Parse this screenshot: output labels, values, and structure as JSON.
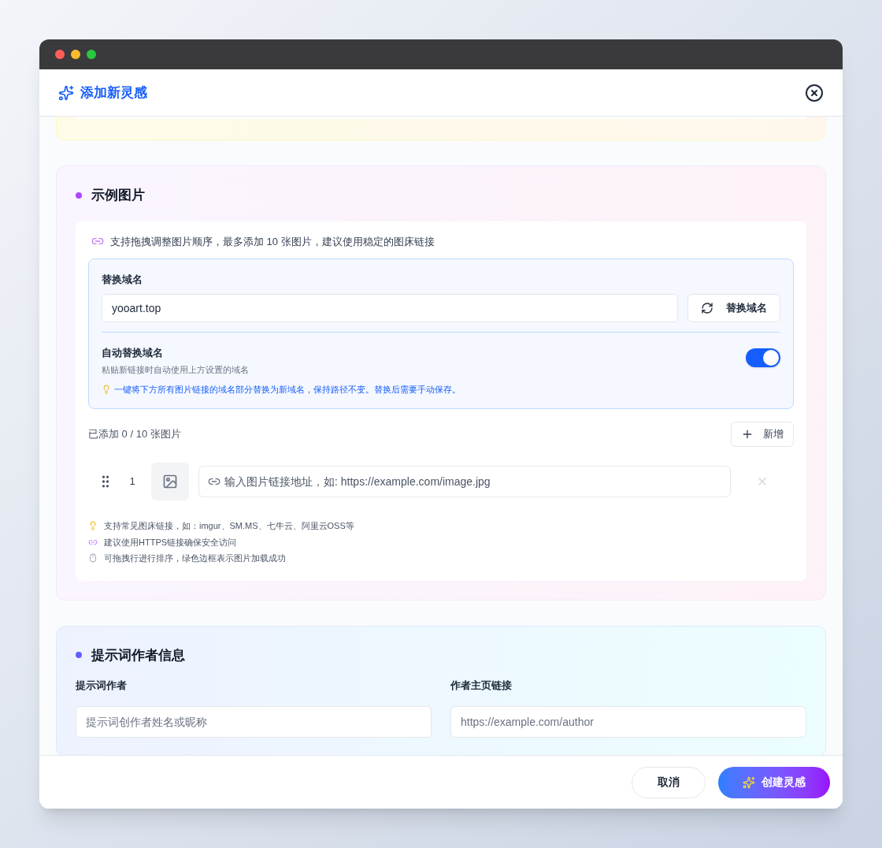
{
  "dialog": {
    "title": "添加新灵感"
  },
  "images_section": {
    "title": "示例图片",
    "hint": "支持拖拽调整图片顺序，最多添加 10 张图片，建议使用稳定的图床链接",
    "domain": {
      "label": "替换域名",
      "value": "yooart.top",
      "button": "替换域名",
      "auto_label": "自动替换域名",
      "auto_desc": "粘贴新链接时自动使用上方设置的域名",
      "auto_on": true,
      "note": "一键将下方所有图片链接的域名部分替换为新域名，保持路径不变。替换后需要手动保存。"
    },
    "count": "已添加 0 / 10 张图片",
    "add_button": "新增",
    "rows": [
      {
        "index": "1",
        "placeholder": "输入图片链接地址，如: https://example.com/image.jpg"
      }
    ],
    "tips": [
      {
        "kind": "bulb",
        "text": "支持常见图床链接，如：imgur、SM.MS、七牛云、阿里云OSS等"
      },
      {
        "kind": "link",
        "text": "建议使用HTTPS链接确保安全访问"
      },
      {
        "kind": "mouse",
        "text": "可拖拽行进行排序，绿色边框表示图片加载成功"
      }
    ]
  },
  "author_section": {
    "title": "提示词作者信息",
    "fields": [
      {
        "label": "提示词作者",
        "placeholder": "提示词创作者姓名或昵称"
      },
      {
        "label": "作者主页链接",
        "placeholder": "https://example.com/author"
      }
    ]
  },
  "footer": {
    "cancel": "取消",
    "create": "创建灵感"
  }
}
